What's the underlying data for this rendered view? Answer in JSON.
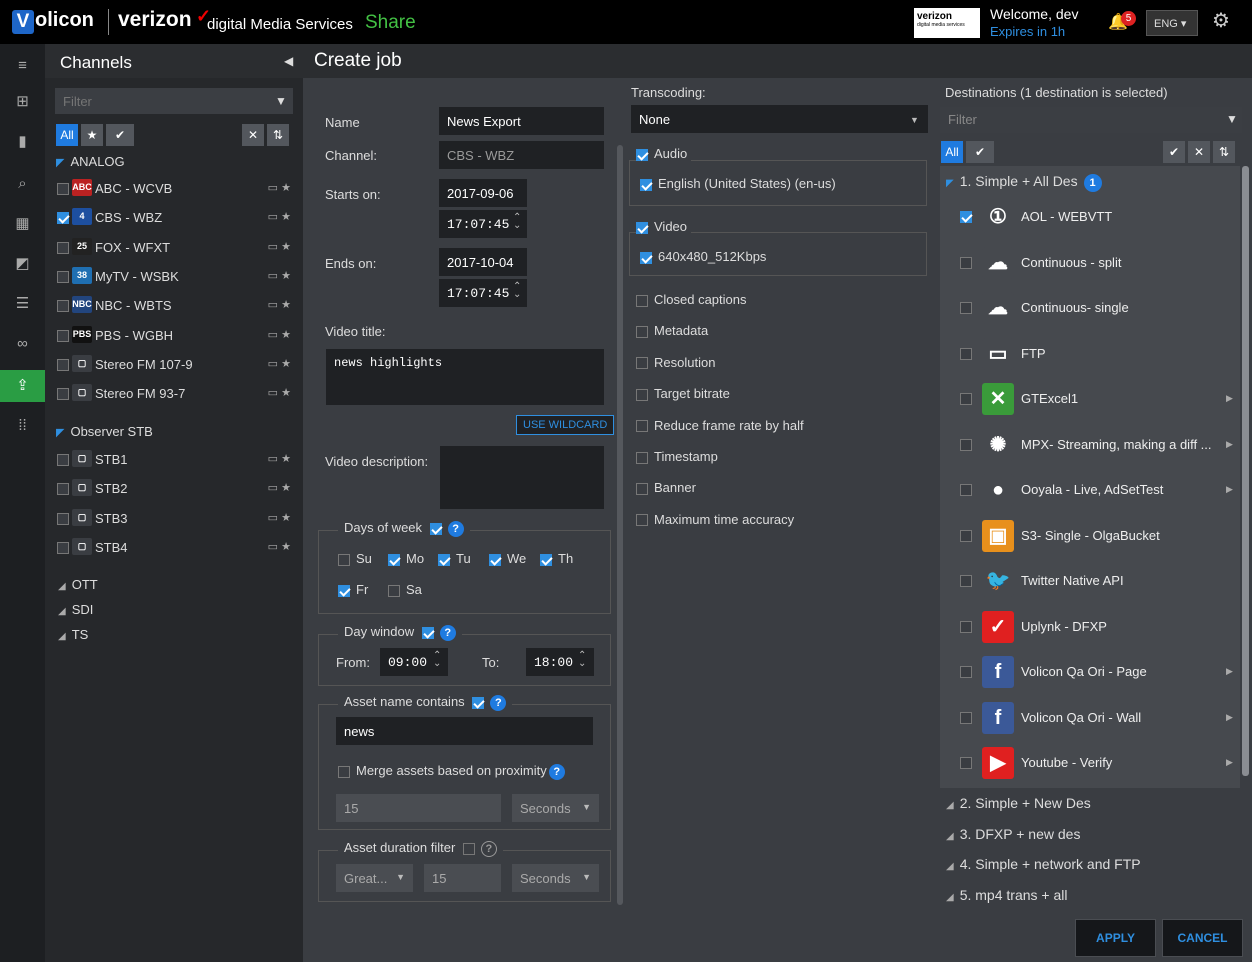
{
  "header": {
    "logo_letter": "V",
    "logo_text": "olicon",
    "brand": "verizon",
    "brand_mark": "✓",
    "brand_sub": "digital Media Services",
    "app_name": "Share",
    "badge_brand": "verizon",
    "badge_sub": "digital media services",
    "welcome": "Welcome, dev",
    "expires": "Expires in 1h",
    "notification_count": "5",
    "language": "ENG ▾",
    "settings_icon": "gear-icon"
  },
  "channels": {
    "title": "Channels",
    "filter_placeholder": "Filter",
    "all_label": "All",
    "groups": [
      {
        "name": "ANALOG",
        "items": [
          {
            "logo": "ABC",
            "label": "ABC - WCVB",
            "checked": false,
            "color": "#b22"
          },
          {
            "logo": "4",
            "label": "CBS - WBZ",
            "checked": true,
            "color": "#1d4fa0"
          },
          {
            "logo": "25",
            "label": "FOX - WFXT",
            "checked": false,
            "color": "#222"
          },
          {
            "logo": "38",
            "label": "MyTV - WSBK",
            "checked": false,
            "color": "#1f6fb2"
          },
          {
            "logo": "NBC",
            "label": "NBC - WBTS",
            "checked": false,
            "color": "#22457e"
          },
          {
            "logo": "PBS",
            "label": "PBS - WGBH",
            "checked": false,
            "color": "#111"
          },
          {
            "logo": "▢",
            "label": "Stereo FM 107-9",
            "checked": false,
            "color": "#3a3d42"
          },
          {
            "logo": "▢",
            "label": "Stereo FM 93-7",
            "checked": false,
            "color": "#3a3d42"
          }
        ]
      },
      {
        "name": "Observer STB",
        "items": [
          {
            "logo": "▢",
            "label": "STB1",
            "checked": false,
            "color": "#3a3d42"
          },
          {
            "logo": "▢",
            "label": "STB2",
            "checked": false,
            "color": "#3a3d42"
          },
          {
            "logo": "▢",
            "label": "STB3",
            "checked": false,
            "color": "#3a3d42"
          },
          {
            "logo": "▢",
            "label": "STB4",
            "checked": false,
            "color": "#3a3d42"
          }
        ]
      }
    ],
    "collapsed_groups": [
      "OTT",
      "SDI",
      "TS"
    ]
  },
  "job": {
    "title": "Create job",
    "name_label": "Name",
    "name_value": "News Export",
    "channel_label": "Channel:",
    "channel_value": "CBS - WBZ",
    "starts_label": "Starts on:",
    "starts_date": "2017-09-06",
    "starts_time": "17:07:45",
    "ends_label": "Ends on:",
    "ends_date": "2017-10-04",
    "ends_time": "17:07:45",
    "video_title_label": "Video title:",
    "video_title_value": "news highlights",
    "wildcard_button": "USE WILDCARD",
    "video_desc_label": "Video description:",
    "days_label": "Days of week",
    "days": [
      {
        "label": "Su",
        "checked": false
      },
      {
        "label": "Mo",
        "checked": true
      },
      {
        "label": "Tu",
        "checked": true
      },
      {
        "label": "We",
        "checked": true
      },
      {
        "label": "Th",
        "checked": true
      },
      {
        "label": "Fr",
        "checked": true
      },
      {
        "label": "Sa",
        "checked": false
      }
    ],
    "day_window_label": "Day window",
    "from_label": "From:",
    "from_value": "09:00",
    "to_label": "To:",
    "to_value": "18:00",
    "asset_name_label": "Asset name contains",
    "asset_name_value": "news",
    "merge_label": "Merge assets based on proximity",
    "merge_value": "15",
    "merge_unit": "Seconds",
    "duration_label": "Asset duration filter",
    "duration_op": "Great...",
    "duration_value": "15",
    "duration_unit": "Seconds"
  },
  "transcoding": {
    "label": "Transcoding:",
    "selected": "None",
    "audio_label": "Audio",
    "audio_track": "English (United States) (en-us)",
    "video_label": "Video",
    "video_profile": "640x480_512Kbps",
    "options": [
      "Closed captions",
      "Metadata",
      "Resolution",
      "Target bitrate",
      "Reduce frame rate by half",
      "Timestamp",
      "Banner",
      "Maximum time accuracy"
    ]
  },
  "destinations": {
    "label": "Destinations (1 destination is selected)",
    "filter_placeholder": "Filter",
    "all_label": "All",
    "group1_name": "1. Simple + All Des",
    "group1_count": "1",
    "items": [
      {
        "label": "AOL - WEBVTT",
        "checked": true,
        "logo": "①",
        "color": "#46494e",
        "arrow": false
      },
      {
        "label": "Continuous - split",
        "checked": false,
        "logo": "☁",
        "color": "#46494e",
        "arrow": false
      },
      {
        "label": "Continuous- single",
        "checked": false,
        "logo": "☁",
        "color": "#46494e",
        "arrow": false
      },
      {
        "label": "FTP",
        "checked": false,
        "logo": "▭",
        "color": "#46494e",
        "arrow": false
      },
      {
        "label": "GTExcel1",
        "checked": false,
        "logo": "✕",
        "color": "#3a9b3a",
        "arrow": true
      },
      {
        "label": "MPX- Streaming, making a diff ...",
        "checked": false,
        "logo": "✺",
        "color": "#46494e",
        "arrow": true
      },
      {
        "label": "Ooyala - Live, AdSetTest",
        "checked": false,
        "logo": "●",
        "color": "#46494e",
        "arrow": true
      },
      {
        "label": "S3- Single - OlgaBucket",
        "checked": false,
        "logo": "▣",
        "color": "#e8901c",
        "arrow": false
      },
      {
        "label": "Twitter Native API",
        "checked": false,
        "logo": "🐦",
        "color": "#46494e",
        "arrow": false
      },
      {
        "label": "Uplynk - DFXP",
        "checked": false,
        "logo": "✓",
        "color": "#e02020",
        "arrow": false
      },
      {
        "label": "Volicon Qa Ori - Page",
        "checked": false,
        "logo": "f",
        "color": "#3b5998",
        "arrow": true
      },
      {
        "label": "Volicon Qa Ori - Wall",
        "checked": false,
        "logo": "f",
        "color": "#3b5998",
        "arrow": true
      },
      {
        "label": "Youtube - Verify",
        "checked": false,
        "logo": "▶",
        "color": "#e02020",
        "arrow": true
      }
    ],
    "collapsed_groups": [
      "2. Simple + New Des",
      "3. DFXP + new des",
      "4. Simple + network and FTP",
      "5. mp4 trans + all"
    ],
    "apply_label": "APPLY",
    "cancel_label": "CANCEL"
  }
}
